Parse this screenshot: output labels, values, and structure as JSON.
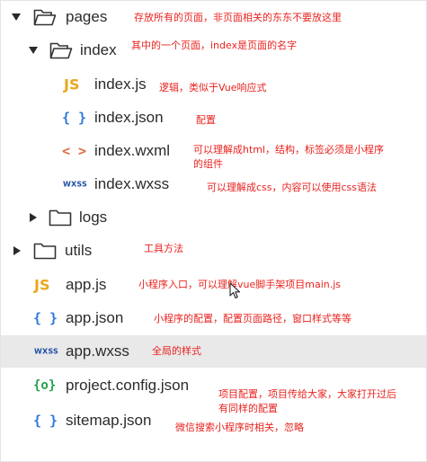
{
  "tree": {
    "pages": {
      "name": "pages",
      "note": "存放所有的页面，非页面相关的东东不要放这里"
    },
    "index": {
      "name": "index",
      "note": "其中的一个页面，index是页面的名字"
    },
    "index_js": {
      "icon": "JS",
      "name": "index.js",
      "note": "逻辑，类似于Vue响应式"
    },
    "index_json": {
      "icon": "{ }",
      "name": "index.json",
      "note": "配置"
    },
    "index_wxml": {
      "icon": "< >",
      "name": "index.wxml",
      "note_line1": "可以理解成html，结构，标签必须是小程序",
      "note_line2": "的组件"
    },
    "index_wxss": {
      "icon": "WXSS",
      "name": "index.wxss",
      "note": "可以理解成css，内容可以使用css语法"
    },
    "logs": {
      "name": "logs"
    },
    "utils": {
      "name": "utils",
      "note": "工具方法"
    },
    "app_js": {
      "icon": "JS",
      "name": "app.js",
      "note": "小程序入口，可以理解vue脚手架项目main.js"
    },
    "app_json": {
      "icon": "{ }",
      "name": "app.json",
      "note": "小程序的配置，配置页面路径，窗口样式等等"
    },
    "app_wxss": {
      "icon": "WXSS",
      "name": "app.wxss",
      "note": "全局的样式"
    },
    "project_config": {
      "icon": "{o}",
      "name": "project.config.json",
      "note_line1": "项目配置，项目传给大家，大家打开过后",
      "note_line2": "有同样的配置"
    },
    "sitemap": {
      "icon": "{ }",
      "name": "sitemap.json",
      "note": "微信搜索小程序时相关，忽略"
    }
  },
  "colors": {
    "annotation": "#e8231f",
    "js_icon": "#e8a81e",
    "json_icon": "#2b79d9",
    "wxml_icon": "#e26b3f",
    "wxss_icon": "#1d4ea3",
    "config_icon": "#23a04a",
    "selected_row": "#e9e9e9"
  }
}
